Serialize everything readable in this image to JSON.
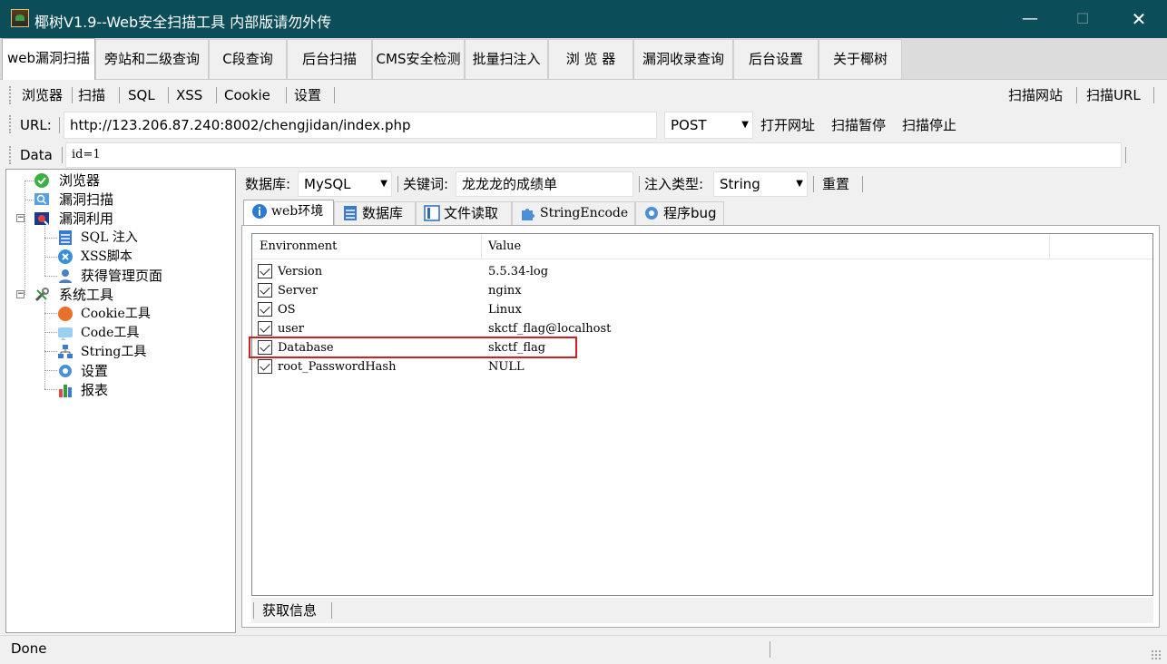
{
  "window": {
    "title": "椰树V1.9--Web安全扫描工具  内部版请勿外传",
    "minimize": "—",
    "maximize": "☐",
    "close": "✕"
  },
  "main_tabs": [
    "web漏洞扫描",
    "旁站和二级查询",
    "C段查询",
    "后台扫描",
    "CMS安全检测",
    "批量扫注入",
    "浏 览 器",
    "漏洞收录查询",
    "后台设置",
    "关于椰树"
  ],
  "toolbar": {
    "browser": "浏览器",
    "scan": "扫描",
    "sql": "SQL",
    "xss": "XSS",
    "cookie": "Cookie",
    "settings": "设置",
    "scan_site": "扫描网站",
    "scan_url": "扫描URL"
  },
  "url_bar": {
    "label": "URL:",
    "value": "http://123.206.87.240:8002/chengjidan/index.php",
    "method": "POST",
    "open": "打开网址",
    "pause": "扫描暂停",
    "stop": "扫描停止"
  },
  "data_bar": {
    "label": "Data",
    "value": "id=1"
  },
  "tree": {
    "browser": "浏览器",
    "vuln_scan": "漏洞扫描",
    "vuln_use": "漏洞利用",
    "sql_inject": "SQL 注入",
    "xss_script": "XSS脚本",
    "admin_page": "获得管理页面",
    "sys_tools": "系统工具",
    "cookie_tool": "Cookie工具",
    "code_tool": "Code工具",
    "string_tool": "String工具",
    "settings": "设置",
    "report": "报表"
  },
  "filter": {
    "db_label": "数据库:",
    "db_value": "MySQL",
    "kw_label": "关键词:",
    "kw_value": "龙龙龙的成绩单",
    "type_label": "注入类型:",
    "type_value": "String",
    "reset": "重置"
  },
  "sub_tabs": [
    "web环境",
    "数据库",
    "文件读取",
    "StringEncode",
    "程序bug"
  ],
  "table": {
    "headers": [
      "Environment",
      "Value"
    ],
    "rows": [
      {
        "env": "Version",
        "value": "5.5.34-log"
      },
      {
        "env": "Server",
        "value": "nginx"
      },
      {
        "env": "OS",
        "value": "Linux"
      },
      {
        "env": "user",
        "value": "skctf_flag@localhost"
      },
      {
        "env": "Database",
        "value": "skctf_flag"
      },
      {
        "env": "root_PasswordHash",
        "value": "NULL"
      }
    ]
  },
  "bottom": {
    "fetch": "获取信息"
  },
  "status": {
    "text": "Done"
  }
}
